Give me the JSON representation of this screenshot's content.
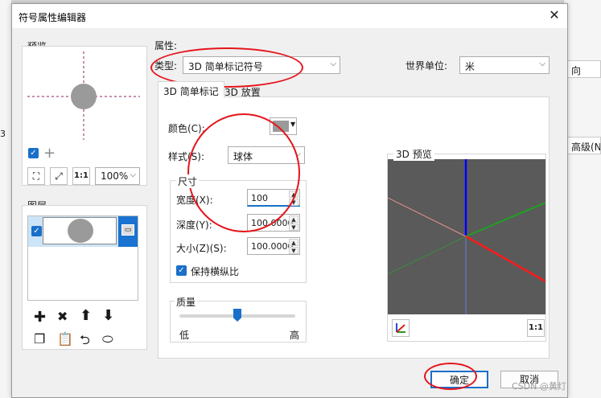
{
  "dialog": {
    "title": "符号属性编辑器",
    "close_glyph": "✕"
  },
  "background_app": {
    "right_cells": [
      "向",
      "高级(N)"
    ],
    "left_fragment": "3"
  },
  "preview": {
    "group_label": "预览",
    "zoom_value": "100%",
    "zoom_options": [
      "100%"
    ],
    "one_to_one": "1:1"
  },
  "layers": {
    "group_label": "图层"
  },
  "properties": {
    "label": "属性:",
    "type_label": "类型:",
    "type_value": "3D 简单标记符号",
    "world_unit_label": "世界单位:",
    "world_unit_value": "米",
    "tabs": [
      "3D 简单标记",
      "3D 放置"
    ],
    "color_label": "颜色(C):",
    "color_value": "#9a9a9a",
    "style_label": "样式(S):",
    "style_value": "球体",
    "size_group_label": "尺寸",
    "width_label": "宽度(X):",
    "width_value": "100",
    "depth_label": "深度(Y):",
    "depth_value": "100.0000",
    "size_label": "大小(Z)(S):",
    "size_value": "100.0000",
    "keep_ratio_label": "保持横纵比",
    "keep_ratio_checked": true,
    "quality_group_label": "质量",
    "quality_low": "低",
    "quality_high": "高",
    "quality_level": 0.5
  },
  "preview3d": {
    "label": "3D 预览",
    "one_to_one": "1:1",
    "bg_color": "#5a5a5a"
  },
  "buttons": {
    "ok": "确定",
    "cancel": "取消"
  },
  "watermark": "CSDN @黄灯"
}
